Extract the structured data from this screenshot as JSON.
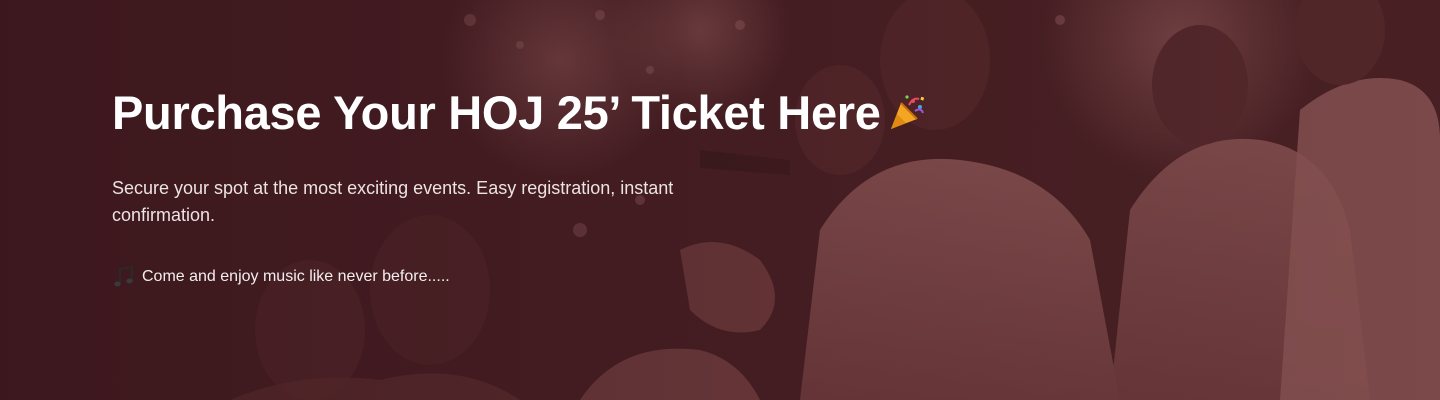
{
  "hero": {
    "title": "Purchase Your HOJ 25’ Ticket Here",
    "title_icon": "party-popper-icon",
    "subtitle": "Secure your spot at the most exciting events. Easy registration, instant confirmation.",
    "note": "Come and enjoy music like never before.....",
    "note_icon": "music-notes-icon",
    "background_image": "choir-singers-photo",
    "colors": {
      "overlay": "#4a1f24",
      "text": "#ffffff",
      "muted_text": "#ece3e3"
    }
  }
}
